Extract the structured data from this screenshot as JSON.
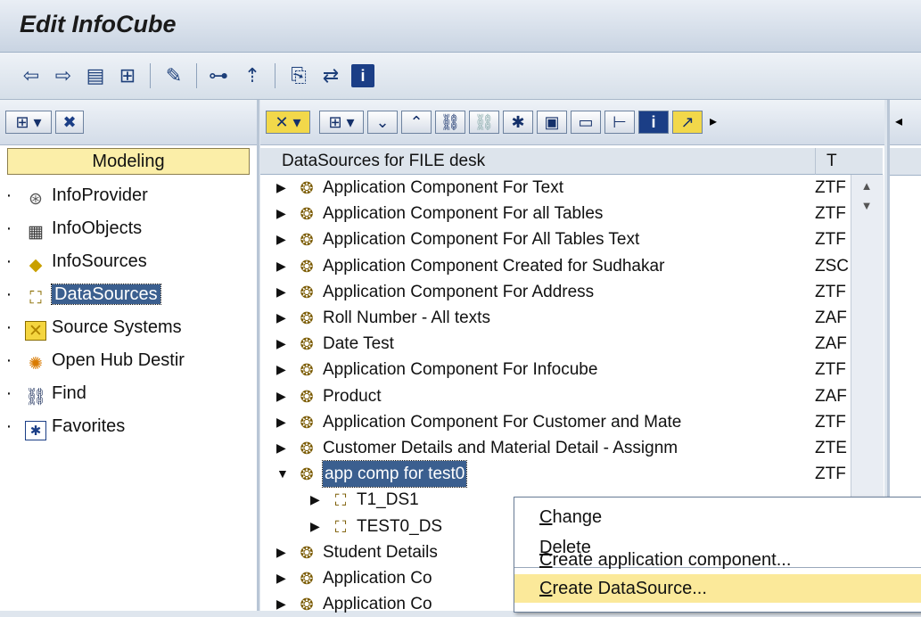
{
  "window": {
    "title": "Edit InfoCube"
  },
  "toolbar": {
    "icons": [
      "back-arrow-icon",
      "forward-arrow-icon",
      "list-view-icon",
      "tree-view-icon",
      "settings-icon",
      "hierarchy-icon",
      "pin-icon",
      "copy-icon",
      "transfer-icon",
      "info-icon"
    ]
  },
  "left_pane": {
    "header": "Modeling",
    "items": [
      {
        "label": "InfoProvider",
        "icon": "infoprovider-icon"
      },
      {
        "label": "InfoObjects",
        "icon": "infoobjects-icon"
      },
      {
        "label": "InfoSources",
        "icon": "infosources-icon"
      },
      {
        "label": "DataSources",
        "icon": "datasources-icon"
      },
      {
        "label": "Source Systems",
        "icon": "source-systems-icon"
      },
      {
        "label": "Open Hub Destir",
        "icon": "open-hub-icon"
      },
      {
        "label": "Find",
        "icon": "binoculars-icon"
      },
      {
        "label": "Favorites",
        "icon": "favorites-icon"
      }
    ]
  },
  "tree": {
    "col1": "DataSources for FILE desk",
    "col2": "T",
    "rows": [
      {
        "label": "Application Component For Text",
        "t": "ZTF",
        "level": 0,
        "arrow": "▶"
      },
      {
        "label": "Application Component For all Tables",
        "t": "ZTF",
        "level": 0,
        "arrow": "▶"
      },
      {
        "label": "Application Component For All Tables Text",
        "t": "ZTF",
        "level": 0,
        "arrow": "▶"
      },
      {
        "label": "Application Component Created for Sudhakar",
        "t": "ZSC",
        "level": 0,
        "arrow": "▶"
      },
      {
        "label": "Application Component For Address",
        "t": "ZTF",
        "level": 0,
        "arrow": "▶"
      },
      {
        "label": "Roll Number - All texts",
        "t": "ZAF",
        "level": 0,
        "arrow": "▶"
      },
      {
        "label": "Date Test",
        "t": "ZAF",
        "level": 0,
        "arrow": "▶"
      },
      {
        "label": "Application Component For Infocube",
        "t": "ZTF",
        "level": 0,
        "arrow": "▶"
      },
      {
        "label": "Product",
        "t": "ZAF",
        "level": 0,
        "arrow": "▶"
      },
      {
        "label": "Application Component For Customer and Mate",
        "t": "ZTF",
        "level": 0,
        "arrow": "▶"
      },
      {
        "label": "Customer Details and Material Detail - Assignm",
        "t": "ZTE",
        "level": 0,
        "arrow": "▶"
      },
      {
        "label": "app comp for test0",
        "t": "ZTF",
        "level": 0,
        "arrow": "▼"
      },
      {
        "label": "T1_DS1",
        "t": "",
        "level": 1,
        "arrow": "▶"
      },
      {
        "label": "TEST0_DS",
        "t": "",
        "level": 1,
        "arrow": "▶"
      },
      {
        "label": "Student Details",
        "t": "",
        "level": 0,
        "arrow": "▶"
      },
      {
        "label": "Application Co",
        "t": "",
        "level": 0,
        "arrow": "▶"
      },
      {
        "label": "Application Co",
        "t": "",
        "level": 0,
        "arrow": "▶"
      }
    ]
  },
  "context_menu": {
    "items": [
      "Change",
      "Delete",
      "Create application component...",
      "Create DataSource..."
    ]
  }
}
